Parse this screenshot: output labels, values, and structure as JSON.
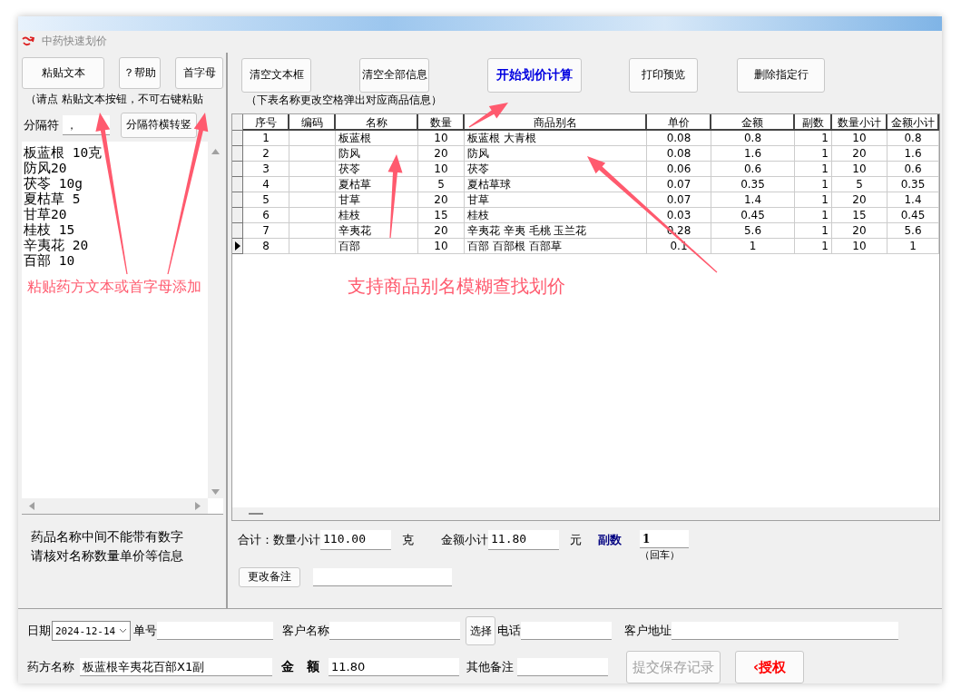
{
  "window": {
    "title": "中药快速划价"
  },
  "left_panel": {
    "buttons": [
      {
        "label": "粘贴文本"
      },
      {
        "label": "？帮助"
      },
      {
        "label": "首字母"
      }
    ],
    "hint": "（请点 粘贴文本按钮，不可右键粘贴",
    "separator_label": "分隔符",
    "separator_value": "，",
    "convert_button": "分隔符横转竖",
    "pasted_text": [
      "板蓝根 10克",
      "防风20",
      "茯苓 10g",
      "夏枯草 5",
      "甘草20",
      "桂枝 15",
      "辛夷花 20",
      "百部 10"
    ],
    "notes": [
      "药品名称中间不能带有数字",
      "请核对名称数量单价等信息"
    ]
  },
  "toolbar": [
    {
      "label": "清空文本框",
      "kind": "normal"
    },
    {
      "label": "清空全部信息",
      "kind": "normal"
    },
    {
      "label": "开始划价计算",
      "kind": "primary"
    },
    {
      "label": "打印预览",
      "kind": "normal"
    },
    {
      "label": "删除指定行",
      "kind": "normal"
    }
  ],
  "table_hint": "（下表名称更改空格弹出对应商品信息）",
  "table": {
    "columns": [
      "序号",
      "编码",
      "名称",
      "数量",
      "商品别名",
      "单价",
      "金额",
      "副数",
      "数量小计",
      "金额小计"
    ],
    "rows": [
      {
        "selected": false,
        "no": "1",
        "name": "板蓝根",
        "qty": "10",
        "alias": "板蓝根 大青根",
        "price": "0.08",
        "amount": "0.8",
        "doses": "1",
        "qty_sub": "10",
        "amount_sub": "0.8"
      },
      {
        "selected": false,
        "no": "2",
        "name": "防风",
        "qty": "20",
        "alias": "防风",
        "price": "0.08",
        "amount": "1.6",
        "doses": "1",
        "qty_sub": "20",
        "amount_sub": "1.6"
      },
      {
        "selected": false,
        "no": "3",
        "name": "茯苓",
        "qty": "10",
        "alias": "茯苓",
        "price": "0.06",
        "amount": "0.6",
        "doses": "1",
        "qty_sub": "10",
        "amount_sub": "0.6"
      },
      {
        "selected": false,
        "no": "4",
        "name": "夏枯草",
        "qty": "5",
        "alias": "夏枯草球",
        "price": "0.07",
        "amount": "0.35",
        "doses": "1",
        "qty_sub": "5",
        "amount_sub": "0.35"
      },
      {
        "selected": false,
        "no": "5",
        "name": "甘草",
        "qty": "20",
        "alias": "甘草",
        "price": "0.07",
        "amount": "1.4",
        "doses": "1",
        "qty_sub": "20",
        "amount_sub": "1.4"
      },
      {
        "selected": false,
        "no": "6",
        "name": "桂枝",
        "qty": "15",
        "alias": "桂枝",
        "price": "0.03",
        "amount": "0.45",
        "doses": "1",
        "qty_sub": "15",
        "amount_sub": "0.45"
      },
      {
        "selected": false,
        "no": "7",
        "name": "辛夷花",
        "qty": "20",
        "alias": "辛夷花 辛夷 毛桃 玉兰花",
        "price": "0.28",
        "amount": "5.6",
        "doses": "1",
        "qty_sub": "20",
        "amount_sub": "5.6"
      },
      {
        "selected": true,
        "no": "8",
        "name": "百部",
        "qty": "10",
        "alias": "百部 百部根 百部草",
        "price": "0.1",
        "amount": "1",
        "doses": "1",
        "qty_sub": "10",
        "amount_sub": "1"
      }
    ]
  },
  "totals": {
    "label": "合计：数量小计",
    "qty_value": "110.00",
    "qty_unit": "克",
    "amount_label": "金额小计",
    "amount_value": "11.80",
    "amount_unit": "元",
    "doses_label": "副数",
    "doses_value": "1",
    "doses_hint": "（回车）",
    "remark_button": "更改备注"
  },
  "order": {
    "date_label": "日期",
    "date_value": "2024-12-14",
    "order_label": "单号",
    "customer_label": "客户名称",
    "select_button": "选择",
    "phone_label": "电话",
    "address_label": "客户地址",
    "recipe_label": "药方名称",
    "recipe_value": "板蓝根辛夷花百部X1副",
    "amount_label": "金　额",
    "amount_value": "11.80",
    "remark_label": "其他备注",
    "submit_button": {
      "label": "提交保存记录",
      "disabled": true
    },
    "license_button": "‹授权"
  },
  "annotations": [
    {
      "text": "粘贴药方文本或首字母添加"
    },
    {
      "text": "支持商品别名模糊查找划价"
    }
  ]
}
